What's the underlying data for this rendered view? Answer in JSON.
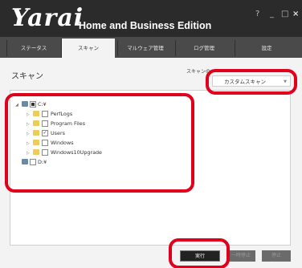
{
  "app": {
    "brand": "Yarai",
    "edition": "Home and Business Edition",
    "window_controls": {
      "help": "?",
      "minimize": "_",
      "maximize": "□",
      "close": "×"
    }
  },
  "tabs": [
    {
      "label": "ステータス",
      "active": false
    },
    {
      "label": "スキャン",
      "active": true
    },
    {
      "label": "マルウェア管理",
      "active": false
    },
    {
      "label": "ログ管理",
      "active": false
    },
    {
      "label": "設定",
      "active": false
    }
  ],
  "page": {
    "title": "スキャン",
    "scan_type_label": "スキャンの",
    "scan_type_value": "カスタムスキャン"
  },
  "tree": [
    {
      "label": "C:¥",
      "state": "partial",
      "kind": "drive",
      "expanded": true
    },
    {
      "label": "PerfLogs",
      "state": "unchecked",
      "kind": "folder"
    },
    {
      "label": "Program Files",
      "state": "unchecked",
      "kind": "folder"
    },
    {
      "label": "Users",
      "state": "checked",
      "kind": "folder"
    },
    {
      "label": "Windows",
      "state": "unchecked",
      "kind": "folder"
    },
    {
      "label": "Windows10Upgrade",
      "state": "unchecked",
      "kind": "folder"
    },
    {
      "label": "D:¥",
      "state": "unchecked",
      "kind": "drive"
    }
  ],
  "buttons": {
    "run": "実行",
    "pause": "一時停止",
    "stop": "停止"
  },
  "colors": {
    "titlebar": "#2b2b2b",
    "tabbar": "#4a4a4a",
    "highlight": "#e0001b",
    "folder": "#efcc5a"
  }
}
